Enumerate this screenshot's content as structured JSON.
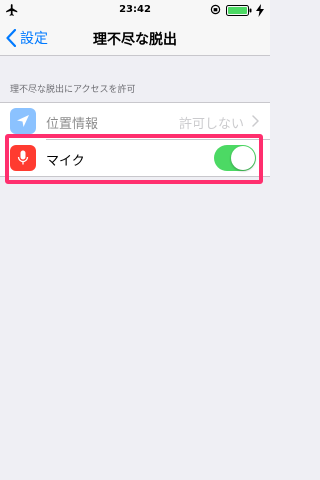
{
  "status_bar": {
    "time": "23:42"
  },
  "nav": {
    "back_label": "設定",
    "title": "理不尽な脱出"
  },
  "section": {
    "header": "理不尽な脱出にアクセスを許可"
  },
  "rows": {
    "location": {
      "label": "位置情報",
      "value": "許可しない",
      "icon_color": "#007aff"
    },
    "microphone": {
      "label": "マイク",
      "icon_color": "#ff3b30",
      "toggle_on": true
    }
  },
  "colors": {
    "accent": "#007aff",
    "toggle_on": "#4cd964",
    "highlight": "#ff2f6e"
  }
}
